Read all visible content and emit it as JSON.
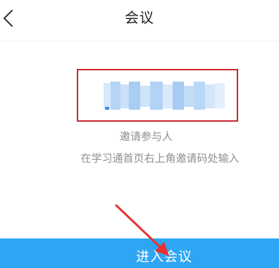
{
  "header": {
    "title": "会议",
    "back_icon": "chevron-left-icon"
  },
  "meeting": {
    "invite_code_redacted": true,
    "invite_label": "邀请参与人",
    "hint": "在学习通首页右上角邀请码处输入"
  },
  "footer": {
    "enter_button_label": "进入会议"
  },
  "colors": {
    "primary": "#2ea6f4",
    "highlight_border": "#c9262b",
    "annotation_arrow": "#e8322f",
    "muted_text": "#8e8e8e",
    "title_text": "#222222"
  }
}
